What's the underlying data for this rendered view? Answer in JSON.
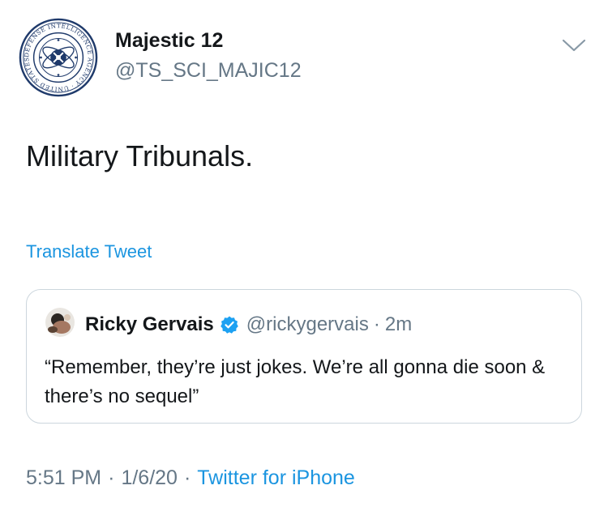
{
  "author": {
    "name": "Majestic 12",
    "handle": "@TS_SCI_MAJIC12",
    "avatar_seal_text": "DEFENSE INTELLIGENCE AGENCY · UNITED STATES OF AMERICA"
  },
  "tweet": {
    "text": "Military Tribunals.",
    "translate_label": "Translate Tweet"
  },
  "quoted_tweet": {
    "name": "Ricky Gervais",
    "verified": true,
    "handle": "@rickygervais",
    "separator": "·",
    "time": "2m",
    "text": "“Remember, they’re just jokes. We’re all gonna die soon & there’s no sequel”"
  },
  "meta": {
    "time": "5:51 PM",
    "date": "1/6/20",
    "separator": "·",
    "source": "Twitter for iPhone"
  },
  "icons": {
    "menu": "chevron-down-icon",
    "verified": "verified-badge-icon"
  },
  "colors": {
    "link": "#1b95e0",
    "muted": "#657786",
    "text": "#14171a",
    "border": "#ccd6dd",
    "seal": "#1f3a6b"
  }
}
